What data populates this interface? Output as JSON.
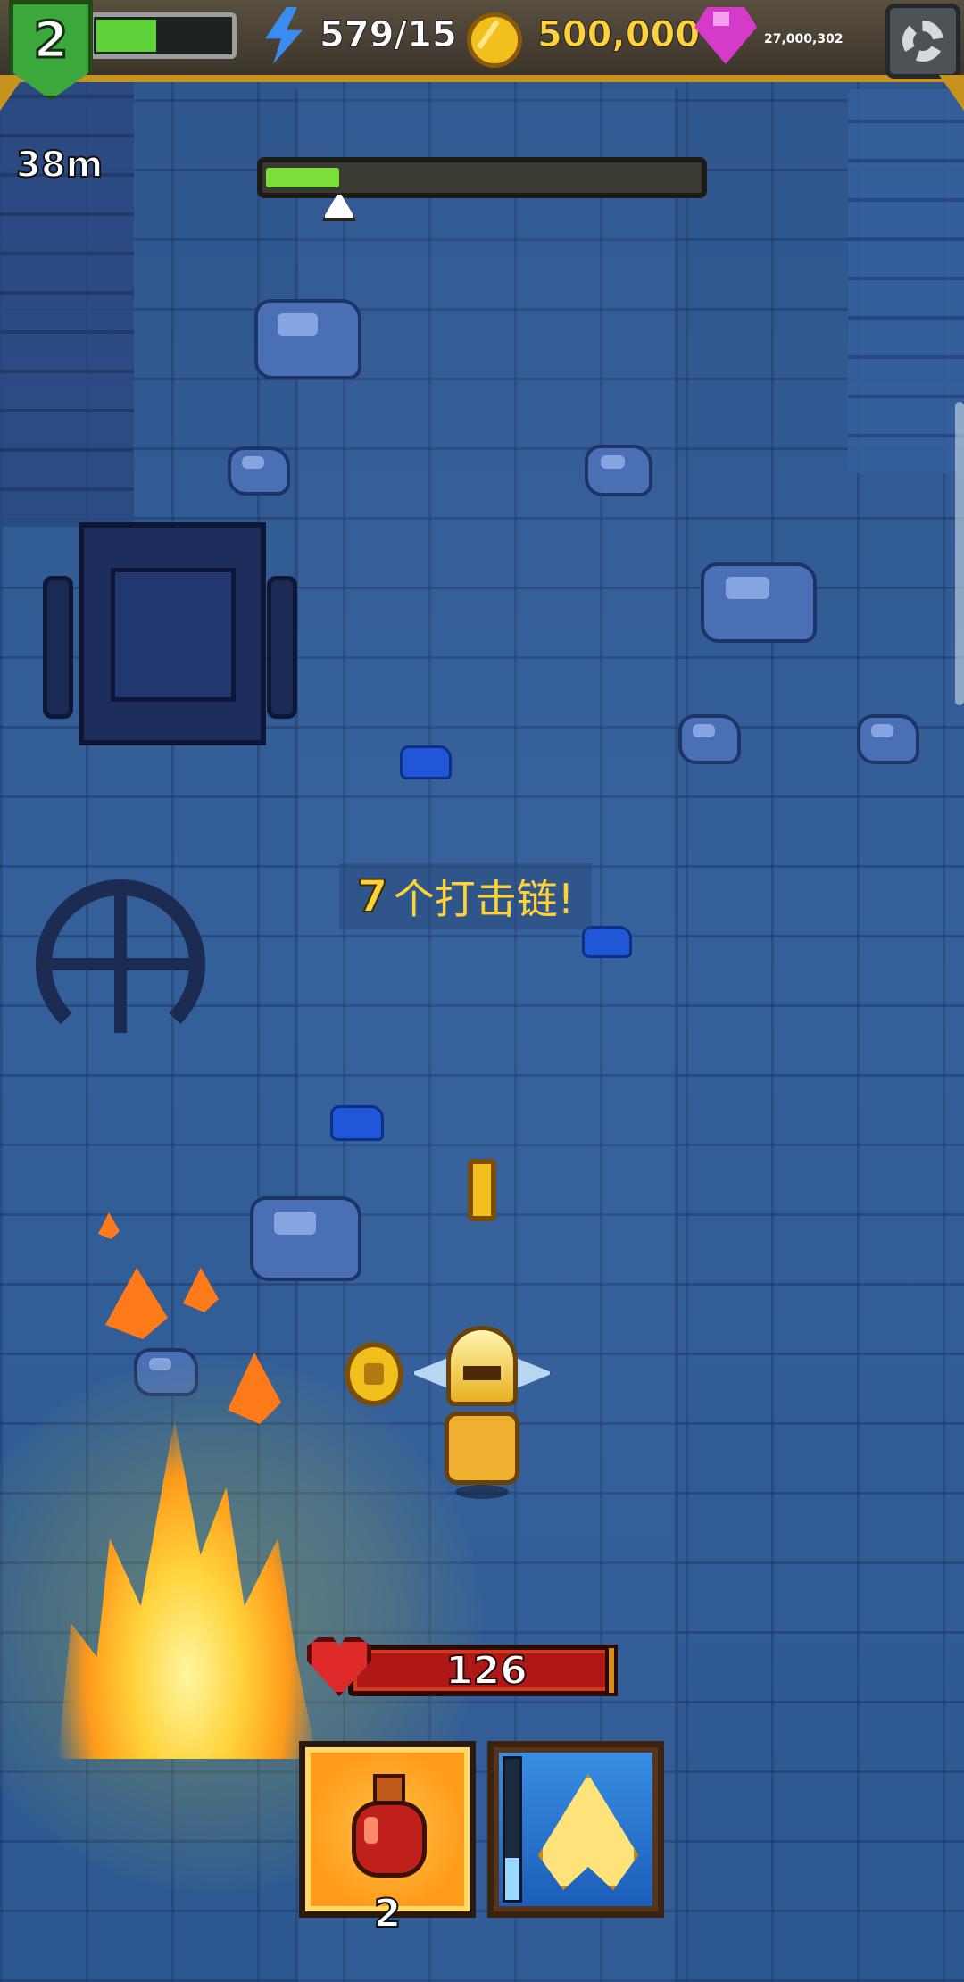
{
  "hud": {
    "level": "2",
    "xp_progress": 0.45,
    "energy": "579/15",
    "gold": "500,000",
    "gems": "27,000,302",
    "icons": {
      "energy": "lightning-bolt-icon",
      "gold": "gold-coin-icon",
      "gems": "purple-gem-icon",
      "settings": "gear-icon"
    }
  },
  "run": {
    "distance": "38m",
    "progress": 0.17
  },
  "combo": {
    "count": "7",
    "label": "个打击链!"
  },
  "player": {
    "hp": "126"
  },
  "skills": {
    "potion_count": "2",
    "skill_cooldown": 0.3
  },
  "colors": {
    "accent_gold": "#ffd23a",
    "xp_green": "#5fd23a",
    "hp_red": "#b01818",
    "floor_blue": "#34609a"
  }
}
